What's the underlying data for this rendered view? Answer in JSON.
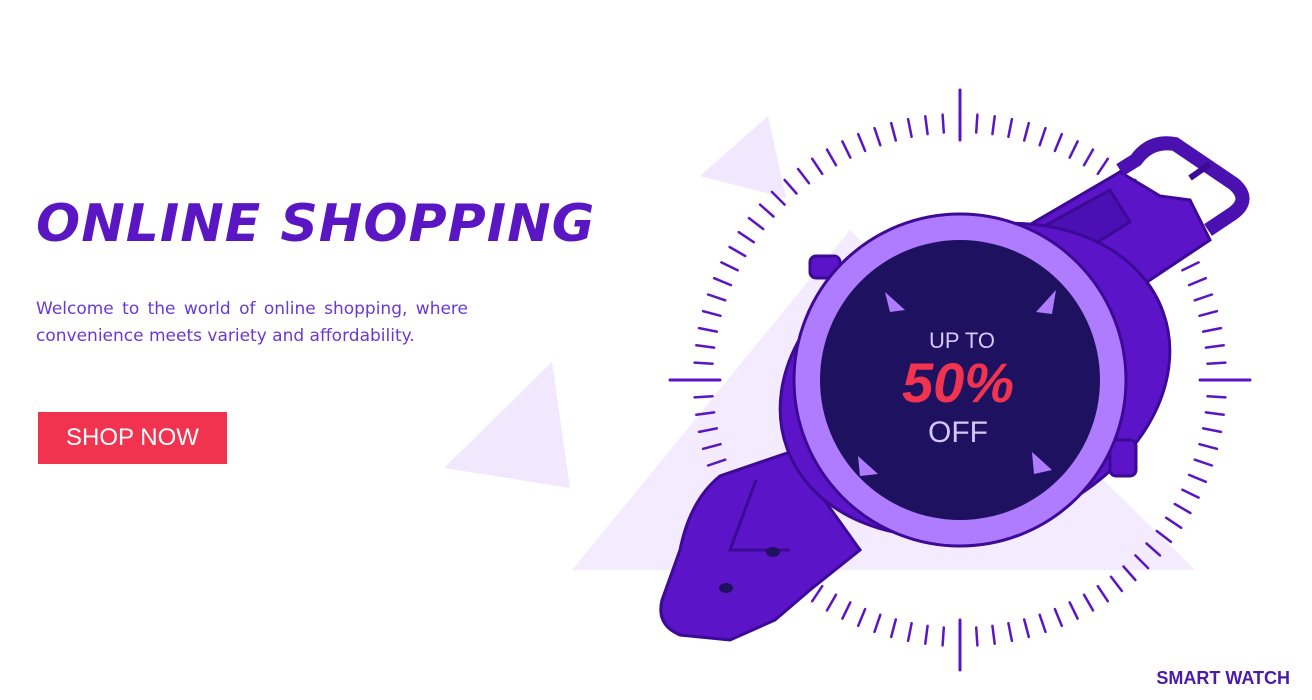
{
  "banner": {
    "headline": "ONLINE SHOPPING",
    "description": "Welcome to the world of online shopping, where convenience meets variety and affordability.",
    "cta_label": "SHOP NOW",
    "watch_face": {
      "line1": "UP TO",
      "line2": "50%",
      "line3": "OFF"
    },
    "corner_label": "SMART WATCH"
  },
  "colors": {
    "accent_purple": "#5b16c4",
    "deep_navy": "#1e1260",
    "bezel_lilac": "#b07cff",
    "cta_red": "#f2334f",
    "triangle_tint": "#f1e8fd"
  },
  "icons": {
    "watch": "smartwatch-illustration",
    "ticks": "radial-tick-marks"
  }
}
